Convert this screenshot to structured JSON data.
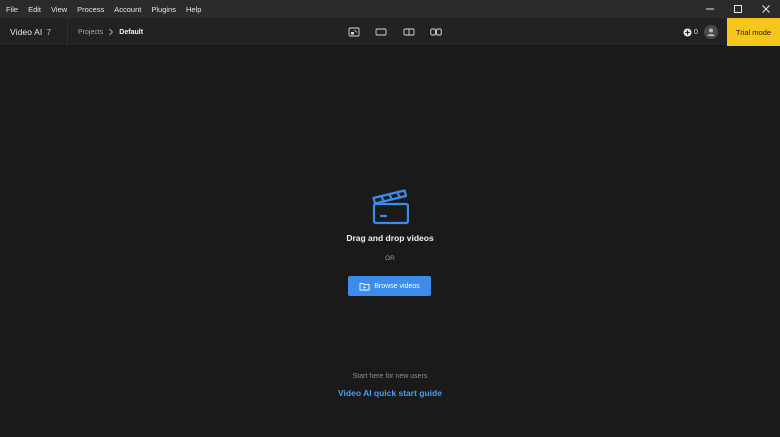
{
  "menu": {
    "items": [
      "File",
      "Edit",
      "View",
      "Process",
      "Account",
      "Plugins",
      "Help"
    ]
  },
  "window_controls": {
    "minimize_icon": "minimize-icon",
    "maximize_icon": "maximize-icon",
    "close_icon": "close-icon"
  },
  "toolbar": {
    "app_name": "Video AI",
    "app_version": "7",
    "breadcrumb": {
      "parent": "Projects",
      "current": "Default"
    },
    "view_modes": [
      "single-view-icon",
      "full-view-icon",
      "split-view-icon",
      "side-by-side-icon"
    ],
    "credits": "0",
    "trial_label": "Trial mode"
  },
  "main": {
    "drop_title": "Drag and drop videos",
    "or_text": "OR",
    "browse_label": "Browse videos",
    "start_here": "Start here for new users",
    "guide_link": "Video AI quick start guide"
  },
  "colors": {
    "background": "#1a1a1a",
    "menubar": "#2b2b2b",
    "toolbar": "#222222",
    "accent_blue": "#3d8bea",
    "link_blue": "#4c9bf2",
    "trial_yellow": "#f7c61b"
  }
}
